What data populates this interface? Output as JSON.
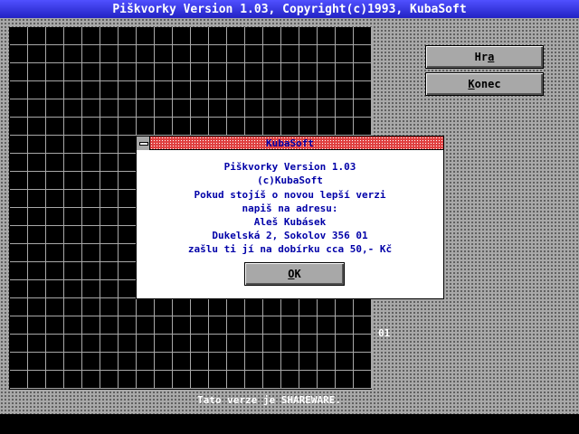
{
  "window": {
    "title": "Piškvorky Version 1.03, Copyright(c)1993, KubaSoft"
  },
  "buttons": {
    "play_pre": "Hr",
    "play_acc": "a",
    "quit_acc": "K",
    "quit_post": "onec"
  },
  "score": "01",
  "status": "Tato verze je SHAREWARE.",
  "dialog": {
    "title": "KubaSoft",
    "lines": [
      "Piškvorky Version 1.03",
      "(c)KubaSoft",
      "Pokud stojíš o novou lepší verzi",
      "napiš na adresu:",
      "Aleš Kubásek",
      "Dukelská 2, Sokolov  356 01",
      "zašlu ti jí na dobírku cca 50,- Kč"
    ],
    "ok_acc": "O",
    "ok_post": "K"
  },
  "colors": {
    "titlebar": "#2020c0",
    "dialog_text": "#0000a8",
    "dialog_titlebar": "#e04040"
  }
}
